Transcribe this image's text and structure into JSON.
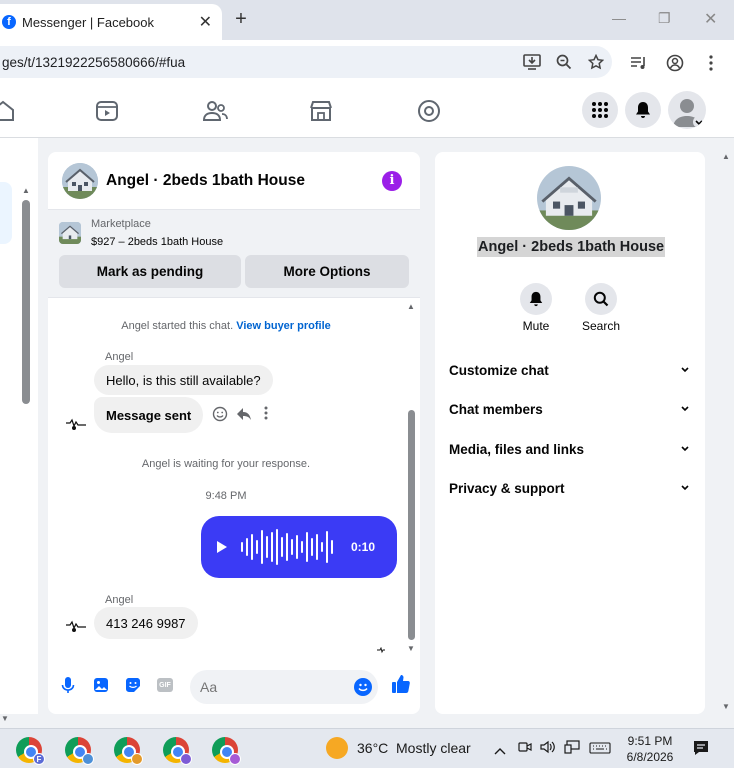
{
  "browser": {
    "tab_title": "Messenger | Facebook",
    "tab_icon_letter": "f",
    "url": "ges/t/1321922256580666/#fua"
  },
  "chat": {
    "title": "Angel · 2beds 1bath House",
    "marketplace": {
      "label": "Marketplace",
      "item": "$927 – 2beds 1bath House",
      "mark_pending": "Mark as pending",
      "more_options": "More Options"
    },
    "system_started": "Angel started this chat.",
    "view_buyer_profile": "View buyer profile",
    "sender_1": "Angel",
    "msg_1": "Hello, is this still available?",
    "msg_2": "Message sent",
    "waiting": "Angel is waiting for your response.",
    "time_1": "9:48 PM",
    "voice_duration": "0:10",
    "sender_2": "Angel",
    "msg_3": "413 246 9987",
    "input_placeholder": "Aa",
    "gif_label": "GIF"
  },
  "info_panel": {
    "title": "Angel · 2beds 1bath House",
    "mute_label": "Mute",
    "search_label": "Search",
    "sections": [
      "Customize chat",
      "Chat members",
      "Media, files and links",
      "Privacy & support"
    ]
  },
  "taskbar": {
    "temperature": "36°C",
    "weather": "Mostly clear",
    "time": "9:51 PM",
    "date": "6/8/2026",
    "badge_letter": "F"
  },
  "colors": {
    "facebook_blue": "#0866ff",
    "voice_bubble": "#3b3bf5",
    "info_purple": "#9b1fe8"
  }
}
